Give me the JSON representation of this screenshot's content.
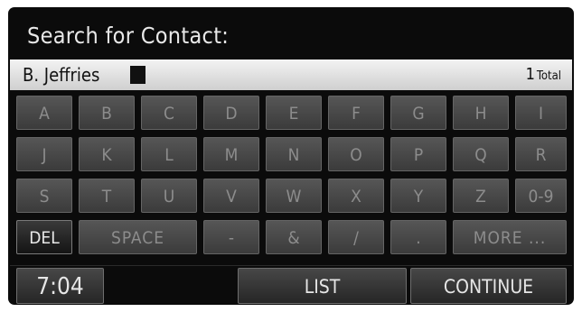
{
  "title": "Search for Contact:",
  "entry": {
    "value": "B. Jeffries",
    "count": "1",
    "count_label": "Total"
  },
  "keys": {
    "row1": [
      "A",
      "B",
      "C",
      "D",
      "E",
      "F",
      "G",
      "H",
      "I"
    ],
    "row2": [
      "J",
      "K",
      "L",
      "M",
      "N",
      "O",
      "P",
      "Q",
      "R"
    ],
    "row3": [
      "S",
      "T",
      "U",
      "V",
      "W",
      "X",
      "Y",
      "Z",
      "0-9"
    ],
    "del": "DEL",
    "space": "SPACE",
    "dash": "-",
    "amp": "&",
    "slash": "/",
    "dot": ".",
    "more": "MORE ..."
  },
  "footer": {
    "time": "7:04",
    "list": "LIST",
    "continue": "CONTINUE"
  }
}
